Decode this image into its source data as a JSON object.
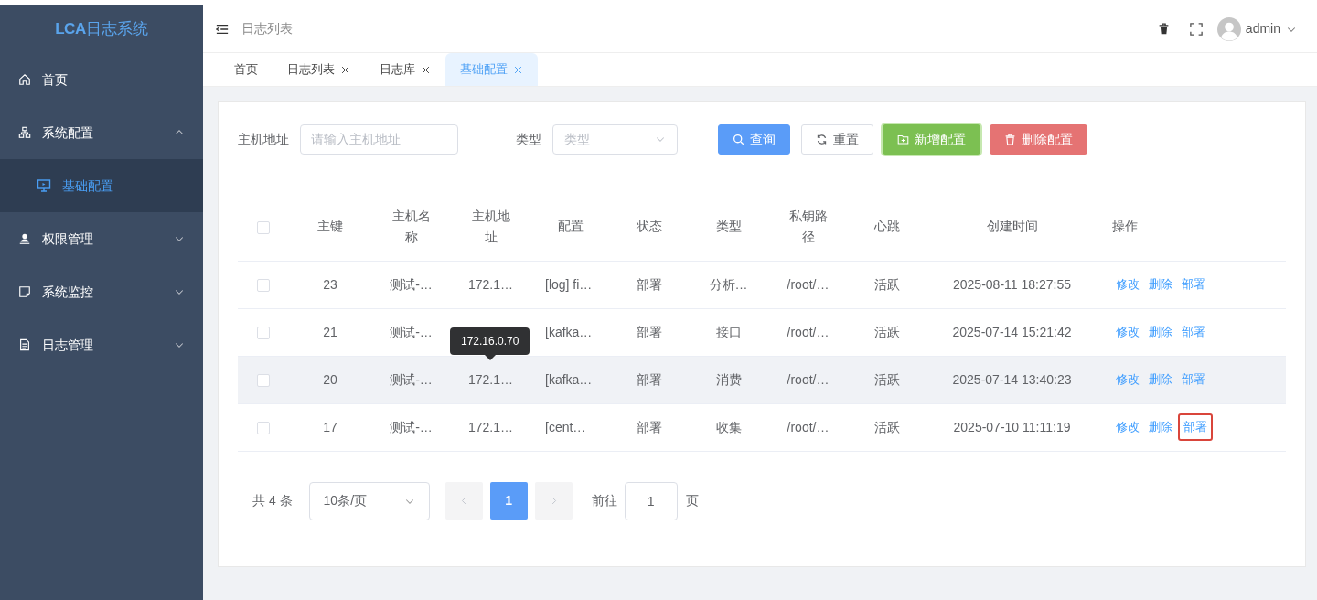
{
  "sidebar": {
    "logo": {
      "mark": "LCA",
      "text": "日志系统"
    },
    "items": [
      {
        "label": "首页",
        "selected": false
      },
      {
        "label": "系统配置",
        "expanded": true,
        "selected": false,
        "children": [
          {
            "label": "基础配置",
            "selected": true
          }
        ]
      },
      {
        "label": "权限管理",
        "expanded": false,
        "selected": false
      },
      {
        "label": "系统监控",
        "expanded": false,
        "selected": false
      },
      {
        "label": "日志管理",
        "expanded": false,
        "selected": false
      }
    ]
  },
  "header": {
    "breadcrumb": "日志列表",
    "user": "admin"
  },
  "tabs": [
    {
      "label": "首页",
      "closable": false,
      "selected": false
    },
    {
      "label": "日志列表",
      "closable": true,
      "selected": false
    },
    {
      "label": "日志库",
      "closable": true,
      "selected": false
    },
    {
      "label": "基础配置",
      "closable": true,
      "selected": true
    }
  ],
  "filters": [
    {
      "label": "主机地址",
      "kind": "input",
      "placeholder": "请输入主机地址"
    },
    {
      "label": "类型",
      "kind": "select",
      "placeholder": "类型"
    }
  ],
  "buttons": [
    {
      "label": "查询",
      "kind": "primary"
    },
    {
      "label": "重置",
      "kind": "default"
    },
    {
      "label": "新增配置",
      "kind": "success"
    },
    {
      "label": "删除配置",
      "kind": "danger"
    }
  ],
  "table": {
    "select_all_checked": false,
    "columns": [
      "主键",
      "主机名称",
      "主机地址",
      "配置",
      "状态",
      "类型",
      "私钥路径",
      "心跳",
      "创建时间",
      "操作"
    ],
    "rows": [
      {
        "checked": false,
        "hovered": false,
        "id": "23",
        "name": "测试-…",
        "host": "172.1…",
        "config": "[log] fi…",
        "status": "部署",
        "type": "分析…",
        "key_path": "/root/…",
        "heartbeat": "活跃",
        "created": "2025-08-11 18:27:55",
        "actions": [
          {
            "label": "修改",
            "outlined": false
          },
          {
            "label": "删除",
            "outlined": false
          },
          {
            "label": "部署",
            "outlined": false
          }
        ]
      },
      {
        "checked": false,
        "hovered": false,
        "id": "21",
        "name": "测试-…",
        "config": "[kafka…",
        "status": "部署",
        "type": "接口",
        "key_path": "/root/…",
        "heartbeat": "活跃",
        "created": "2025-07-14 15:21:42",
        "actions": [
          {
            "label": "修改",
            "outlined": false
          },
          {
            "label": "删除",
            "outlined": false
          },
          {
            "label": "部署",
            "outlined": false
          }
        ]
      },
      {
        "checked": false,
        "hovered": true,
        "id": "20",
        "name": "测试-…",
        "host": "172.1…",
        "host_tooltip": "172.16.0.70",
        "config": "[kafka…",
        "status": "部署",
        "type": "消费",
        "key_path": "/root/…",
        "heartbeat": "活跃",
        "created": "2025-07-14 13:40:23",
        "actions": [
          {
            "label": "修改",
            "outlined": false
          },
          {
            "label": "删除",
            "outlined": false
          },
          {
            "label": "部署",
            "outlined": false
          }
        ]
      },
      {
        "checked": false,
        "hovered": false,
        "id": "17",
        "name": "测试-…",
        "host": "172.1…",
        "config": "[cent…",
        "status": "部署",
        "type": "收集",
        "key_path": "/root/…",
        "heartbeat": "活跃",
        "created": "2025-07-10 11:11:19",
        "actions": [
          {
            "label": "修改",
            "outlined": false
          },
          {
            "label": "删除",
            "outlined": false
          },
          {
            "label": "部署",
            "outlined": true
          }
        ]
      }
    ]
  },
  "pagination": {
    "total": "共 4 条",
    "page_size": "10条/页",
    "pages": [
      {
        "label": "1",
        "selected": true
      }
    ],
    "goto_label": "前往",
    "goto_value": "1",
    "goto_suffix": "页"
  }
}
